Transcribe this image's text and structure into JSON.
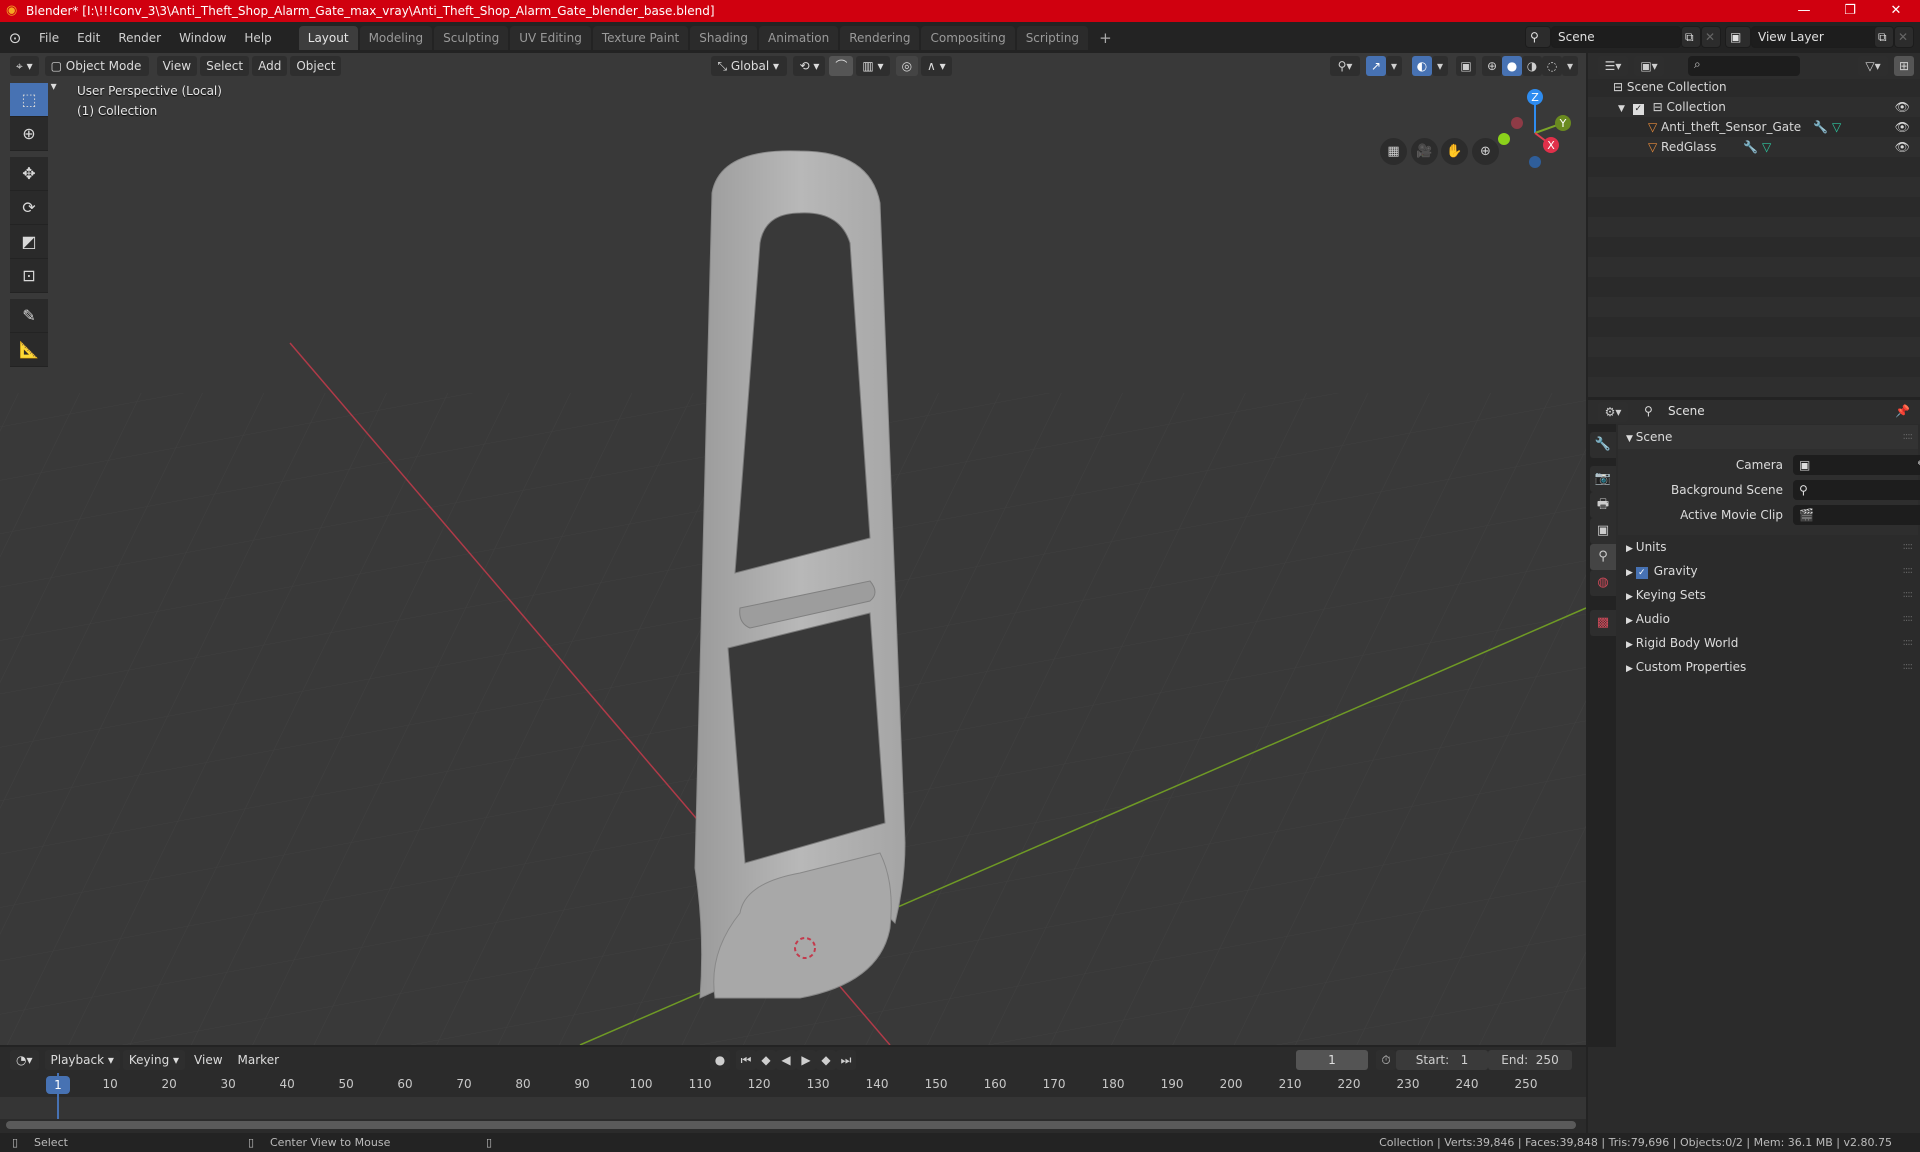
{
  "window": {
    "title": "Blender* [I:\\!!!conv_3\\3\\Anti_Theft_Shop_Alarm_Gate_max_vray\\Anti_Theft_Shop_Alarm_Gate_blender_base.blend]",
    "controls": {
      "minimize": "—",
      "maximize": "❐",
      "close": "✕"
    }
  },
  "menubar": {
    "menus": [
      "File",
      "Edit",
      "Render",
      "Window",
      "Help"
    ],
    "workspaces": [
      "Layout",
      "Modeling",
      "Sculpting",
      "UV Editing",
      "Texture Paint",
      "Shading",
      "Animation",
      "Rendering",
      "Compositing",
      "Scripting"
    ],
    "active_workspace": "Layout",
    "add_workspace": "+",
    "scene_name": "Scene",
    "view_layer": "View Layer"
  },
  "viewport": {
    "header": {
      "mode": "Object Mode",
      "menus": [
        "View",
        "Select",
        "Add",
        "Object"
      ],
      "orientation": "Global"
    },
    "overlay_text": {
      "perspective": "User Perspective (Local)",
      "collection": "(1) Collection"
    },
    "gizmo": {
      "z": "Z",
      "y": "Y",
      "x": "X"
    },
    "colors": {
      "x_axis": "#c33a4c",
      "y_axis": "#7ba428",
      "z_axis": "#2e8cf0",
      "selected": "#4772b3"
    }
  },
  "outliner": {
    "search_placeholder": "",
    "root": "Scene Collection",
    "collection": "Collection",
    "objects": [
      {
        "name": "Anti_theft_Sensor_Gate"
      },
      {
        "name": "RedGlass"
      }
    ]
  },
  "properties": {
    "context": "Scene",
    "panel_title": "Scene",
    "fields": [
      {
        "label": "Camera",
        "value": ""
      },
      {
        "label": "Background Scene",
        "value": ""
      },
      {
        "label": "Active Movie Clip",
        "value": ""
      }
    ],
    "subpanels": [
      "Units",
      "Gravity",
      "Keying Sets",
      "Audio",
      "Rigid Body World",
      "Custom Properties"
    ],
    "gravity_checked": true
  },
  "timeline": {
    "menus": [
      "Playback",
      "Keying",
      "View",
      "Marker"
    ],
    "current_frame": "1",
    "start_label": "Start:",
    "start": "1",
    "end_label": "End:",
    "end": "250",
    "ruler": [
      "1",
      "10",
      "20",
      "30",
      "40",
      "50",
      "60",
      "70",
      "80",
      "90",
      "100",
      "110",
      "120",
      "130",
      "140",
      "150",
      "160",
      "170",
      "180",
      "190",
      "200",
      "210",
      "220",
      "230",
      "240",
      "250"
    ]
  },
  "statusbar": {
    "left": [
      {
        "action": "Select"
      },
      {
        "action": "Center View to Mouse"
      },
      {
        "action": ""
      }
    ],
    "stats": "Collection | Verts:39,846 | Faces:39,848 | Tris:79,696 | Objects:0/2 | Mem: 36.1 MB | v2.80.75"
  }
}
